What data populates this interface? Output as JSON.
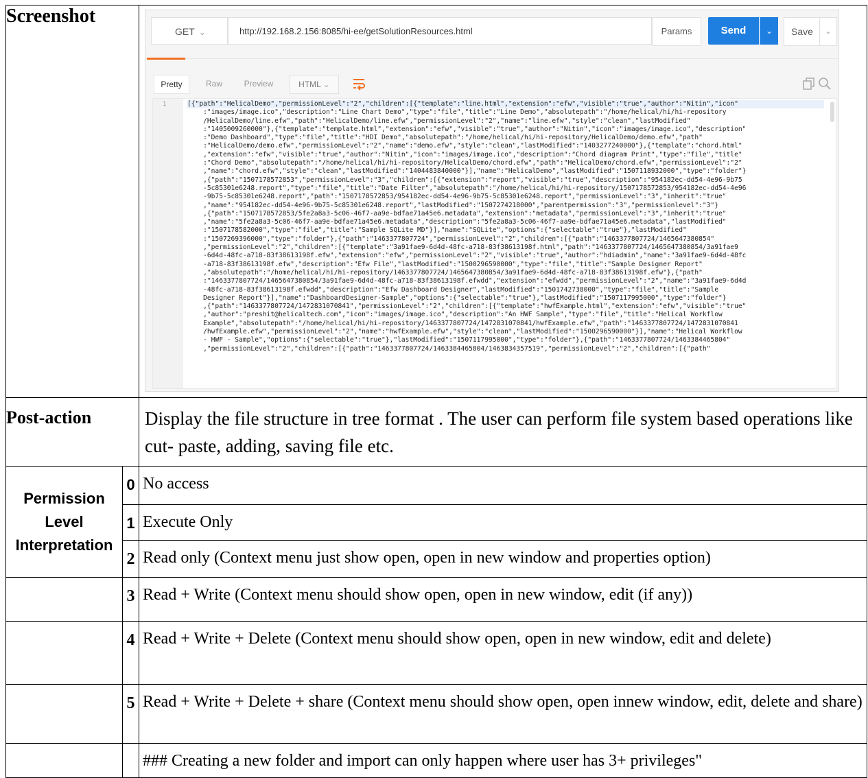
{
  "table": {
    "screenshot_label": "Screenshot",
    "post_action_label": "Post-action",
    "post_action_text": "Display the file structure in tree format . The user can perform file system based operations like cut- paste, adding, saving file etc.",
    "permission_label": "Permission Level Interpretation",
    "levels": [
      {
        "num": "0",
        "text": "No access"
      },
      {
        "num": "1",
        "text": "Execute Only"
      },
      {
        "num": "2",
        "text": "Read only (Context menu just show open, open in new window and properties option)"
      },
      {
        "num": "3",
        "text": "Read + Write (Context menu should show open, open in new window, edit (if any))"
      },
      {
        "num": "4",
        "text": "Read + Write + Delete (Context menu should show open, open in new window, edit and delete)"
      },
      {
        "num": "5",
        "text": "Read + Write + Delete + share (Context menu should show open, open innew window, edit, delete and share)"
      },
      {
        "num": "",
        "text": "### Creating a new folder and import can only happen where user has 3+ privileges\""
      }
    ]
  },
  "postman": {
    "method": "GET",
    "url": "http://192.168.2.156:8085/hi-ee/getSolutionResources.html",
    "params_label": "Params",
    "send_label": "Send",
    "save_label": "Save",
    "response_tabs": {
      "pretty": "Pretty",
      "raw": "Raw",
      "preview": "Preview",
      "format": "HTML"
    },
    "line_number": "1",
    "response_lines": [
      "[{\"path\":\"HelicalDemo\",\"permissionLevel\":\"2\",\"children\":[{\"template\":\"line.html\",\"extension\":\"efw\",\"visible\":\"true\",\"author\":\"Nitin\",\"icon\"",
      "    :\"images/image.ico\",\"description\":\"Line Chart Demo\",\"type\":\"file\",\"title\":\"Line Demo\",\"absolutepath\":\"/home/helical/hi/hi-repository",
      "    /HelicalDemo/line.efw\",\"path\":\"HelicalDemo/line.efw\",\"permissionLevel\":\"2\",\"name\":\"line.efw\",\"style\":\"clean\",\"lastModified\"",
      "    :\"1405009260000\"},{\"template\":\"template.html\",\"extension\":\"efw\",\"visible\":\"true\",\"author\":\"Nitin\",\"icon\":\"images/image.ico\",\"description\"",
      "    :\"Demo Dashboard\",\"type\":\"file\",\"title\":\"HDI Demo\",\"absolutepath\":\"/home/helical/hi/hi-repository/HelicalDemo/demo.efw\",\"path\"",
      "    :\"HelicalDemo/demo.efw\",\"permissionLevel\":\"2\",\"name\":\"demo.efw\",\"style\":\"clean\",\"lastModified\":\"1403277240000\"},{\"template\":\"chord.html\"",
      "    ,\"extension\":\"efw\",\"visible\":\"true\",\"author\":\"Nitin\",\"icon\":\"images/image.ico\",\"description\":\"Chord diagram Print\",\"type\":\"file\",\"title\"",
      "    :\"Chord Demo\",\"absolutepath\":\"/home/helical/hi/hi-repository/HelicalDemo/chord.efw\",\"path\":\"HelicalDemo/chord.efw\",\"permissionLevel\":\"2\"",
      "    ,\"name\":\"chord.efw\",\"style\":\"clean\",\"lastModified\":\"1404483840000\"}],\"name\":\"HelicalDemo\",\"lastModified\":\"1507118932000\",\"type\":\"folder\"}",
      "    ,{\"path\":\"1507178572853\",\"permissionLevel\":\"3\",\"children\":[{\"extension\":\"report\",\"visible\":\"true\",\"description\":\"954182ec-dd54-4e96-9b75",
      "    -5c85301e6248.report\",\"type\":\"file\",\"title\":\"Date Filter\",\"absolutepath\":\"/home/helical/hi/hi-repository/1507178572853/954182ec-dd54-4e96",
      "    -9b75-5c85301e6248.report\",\"path\":\"1507178572853/954182ec-dd54-4e96-9b75-5c85301e6248.report\",\"permissionLevel\":\"3\",\"inherit\":\"true\"",
      "    ,\"name\":\"954182ec-dd54-4e96-9b75-5c85301e6248.report\",\"lastModified\":\"1507274218000\",\"parentpermission\":\"3\",\"permissionlevel\":\"3\"}",
      "    ,{\"path\":\"1507178572853/5fe2a8a3-5c06-46f7-aa9e-bdfae71a45e6.metadata\",\"extension\":\"metadata\",\"permissionLevel\":\"3\",\"inherit\":\"true\"",
      "    ,\"name\":\"5fe2a8a3-5c06-46f7-aa9e-bdfae71a45e6.metadata\",\"description\":\"5fe2a8a3-5c06-46f7-aa9e-bdfae71a45e6.metadata\",\"lastModified\"",
      "    :\"1507178582000\",\"type\":\"file\",\"title\":\"Sample SQLite MD\"}],\"name\":\"SQLite\",\"options\":{\"selectable\":\"true\"},\"lastModified\"",
      "    :\"1507269396000\",\"type\":\"folder\"},{\"path\":\"1463377807724\",\"permissionLevel\":\"2\",\"children\":[{\"path\":\"1463377807724/1465647380854\"",
      "    ,\"permissionLevel\":\"2\",\"children\":[{\"template\":\"3a91fae9-6d4d-48fc-a718-83f38613198f.html\",\"path\":\"1463377807724/1465647380854/3a91fae9",
      "    -6d4d-48fc-a718-83f38613198f.efw\",\"extension\":\"efw\",\"permissionLevel\":\"2\",\"visible\":\"true\",\"author\":\"hdiadmin\",\"name\":\"3a91fae9-6d4d-48fc",
      "    -a718-83f38613198f.efw\",\"description\":\"Efw File\",\"lastModified\":\"1500296590000\",\"type\":\"file\",\"title\":\"Sample Designer Report\"",
      "    ,\"absolutepath\":\"/home/helical/hi/hi-repository/1463377807724/1465647380854/3a91fae9-6d4d-48fc-a718-83f38613198f.efw\"},{\"path\"",
      "    :\"1463377807724/1465647380854/3a91fae9-6d4d-48fc-a718-83f38613198f.efwdd\",\"extension\":\"efwdd\",\"permissionLevel\":\"2\",\"name\":\"3a91fae9-6d4d",
      "    -48fc-a718-83f38613198f.efwdd\",\"description\":\"Efw Dashboard Designer\",\"lastModified\":\"1501742738000\",\"type\":\"file\",\"title\":\"Sample",
      "    Designer Report\"}],\"name\":\"DashboardDesigner-Sample\",\"options\":{\"selectable\":\"true\"},\"lastModified\":\"1507117995000\",\"type\":\"folder\"}",
      "    ,{\"path\":\"1463377807724/1472831070841\",\"permissionLevel\":\"2\",\"children\":[{\"template\":\"hwfExample.html\",\"extension\":\"efw\",\"visible\":\"true\"",
      "    ,\"author\":\"preshit@helicaltech.com\",\"icon\":\"images/image.ico\",\"description\":\"An HWF Sample\",\"type\":\"file\",\"title\":\"Helical Workflow",
      "    Example\",\"absolutepath\":\"/home/helical/hi/hi-repository/1463377807724/1472831070841/hwfExample.efw\",\"path\":\"1463377807724/1472831070841",
      "    /hwfExample.efw\",\"permissionLevel\":\"2\",\"name\":\"hwfExample.efw\",\"style\":\"clean\",\"lastModified\":\"1500296590000\"}],\"name\":\"Helical Workflow",
      "    - HWF - Sample\",\"options\":{\"selectable\":\"true\"},\"lastModified\":\"1507117995000\",\"type\":\"folder\"},{\"path\":\"1463377807724/1463384465804\"",
      "    ,\"permissionLevel\":\"2\",\"children\":[{\"path\":\"1463377807724/1463384465804/1463834357519\",\"permissionLevel\":\"2\",\"children\":[{\"path\""
    ]
  }
}
